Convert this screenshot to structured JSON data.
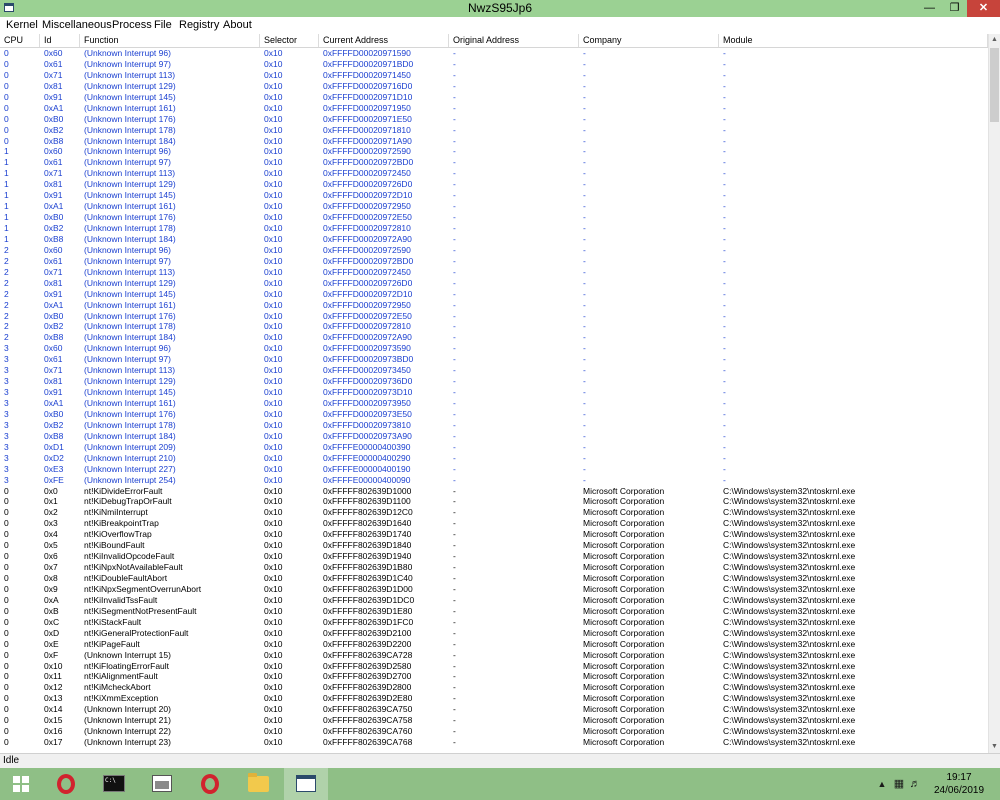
{
  "window": {
    "title": "NwzS95Jp6"
  },
  "menu": [
    "Kernel",
    "Miscellaneous",
    "Process",
    "File",
    "Registry",
    "About"
  ],
  "columns": [
    "CPU",
    "Id",
    "Function",
    "Selector",
    "Current Address",
    "Original Address",
    "Company",
    "Module"
  ],
  "rows": [
    [
      "0",
      "0x60",
      "(Unknown Interrupt 96)",
      "0x10",
      "0xFFFFD00020971590",
      "-",
      "-",
      "-"
    ],
    [
      "0",
      "0x61",
      "(Unknown Interrupt 97)",
      "0x10",
      "0xFFFFD00020971BD0",
      "-",
      "-",
      "-"
    ],
    [
      "0",
      "0x71",
      "(Unknown Interrupt 113)",
      "0x10",
      "0xFFFFD00020971450",
      "-",
      "-",
      "-"
    ],
    [
      "0",
      "0x81",
      "(Unknown Interrupt 129)",
      "0x10",
      "0xFFFFD000209716D0",
      "-",
      "-",
      "-"
    ],
    [
      "0",
      "0x91",
      "(Unknown Interrupt 145)",
      "0x10",
      "0xFFFFD00020971D10",
      "-",
      "-",
      "-"
    ],
    [
      "0",
      "0xA1",
      "(Unknown Interrupt 161)",
      "0x10",
      "0xFFFFD00020971950",
      "-",
      "-",
      "-"
    ],
    [
      "0",
      "0xB0",
      "(Unknown Interrupt 176)",
      "0x10",
      "0xFFFFD00020971E50",
      "-",
      "-",
      "-"
    ],
    [
      "0",
      "0xB2",
      "(Unknown Interrupt 178)",
      "0x10",
      "0xFFFFD00020971810",
      "-",
      "-",
      "-"
    ],
    [
      "0",
      "0xB8",
      "(Unknown Interrupt 184)",
      "0x10",
      "0xFFFFD00020971A90",
      "-",
      "-",
      "-"
    ],
    [
      "1",
      "0x60",
      "(Unknown Interrupt 96)",
      "0x10",
      "0xFFFFD00020972590",
      "-",
      "-",
      "-"
    ],
    [
      "1",
      "0x61",
      "(Unknown Interrupt 97)",
      "0x10",
      "0xFFFFD00020972BD0",
      "-",
      "-",
      "-"
    ],
    [
      "1",
      "0x71",
      "(Unknown Interrupt 113)",
      "0x10",
      "0xFFFFD00020972450",
      "-",
      "-",
      "-"
    ],
    [
      "1",
      "0x81",
      "(Unknown Interrupt 129)",
      "0x10",
      "0xFFFFD000209726D0",
      "-",
      "-",
      "-"
    ],
    [
      "1",
      "0x91",
      "(Unknown Interrupt 145)",
      "0x10",
      "0xFFFFD00020972D10",
      "-",
      "-",
      "-"
    ],
    [
      "1",
      "0xA1",
      "(Unknown Interrupt 161)",
      "0x10",
      "0xFFFFD00020972950",
      "-",
      "-",
      "-"
    ],
    [
      "1",
      "0xB0",
      "(Unknown Interrupt 176)",
      "0x10",
      "0xFFFFD00020972E50",
      "-",
      "-",
      "-"
    ],
    [
      "1",
      "0xB2",
      "(Unknown Interrupt 178)",
      "0x10",
      "0xFFFFD00020972810",
      "-",
      "-",
      "-"
    ],
    [
      "1",
      "0xB8",
      "(Unknown Interrupt 184)",
      "0x10",
      "0xFFFFD00020972A90",
      "-",
      "-",
      "-"
    ],
    [
      "2",
      "0x60",
      "(Unknown Interrupt 96)",
      "0x10",
      "0xFFFFD00020972590",
      "-",
      "-",
      "-"
    ],
    [
      "2",
      "0x61",
      "(Unknown Interrupt 97)",
      "0x10",
      "0xFFFFD00020972BD0",
      "-",
      "-",
      "-"
    ],
    [
      "2",
      "0x71",
      "(Unknown Interrupt 113)",
      "0x10",
      "0xFFFFD00020972450",
      "-",
      "-",
      "-"
    ],
    [
      "2",
      "0x81",
      "(Unknown Interrupt 129)",
      "0x10",
      "0xFFFFD000209726D0",
      "-",
      "-",
      "-"
    ],
    [
      "2",
      "0x91",
      "(Unknown Interrupt 145)",
      "0x10",
      "0xFFFFD00020972D10",
      "-",
      "-",
      "-"
    ],
    [
      "2",
      "0xA1",
      "(Unknown Interrupt 161)",
      "0x10",
      "0xFFFFD00020972950",
      "-",
      "-",
      "-"
    ],
    [
      "2",
      "0xB0",
      "(Unknown Interrupt 176)",
      "0x10",
      "0xFFFFD00020972E50",
      "-",
      "-",
      "-"
    ],
    [
      "2",
      "0xB2",
      "(Unknown Interrupt 178)",
      "0x10",
      "0xFFFFD00020972810",
      "-",
      "-",
      "-"
    ],
    [
      "2",
      "0xB8",
      "(Unknown Interrupt 184)",
      "0x10",
      "0xFFFFD00020972A90",
      "-",
      "-",
      "-"
    ],
    [
      "3",
      "0x60",
      "(Unknown Interrupt 96)",
      "0x10",
      "0xFFFFD00020973590",
      "-",
      "-",
      "-"
    ],
    [
      "3",
      "0x61",
      "(Unknown Interrupt 97)",
      "0x10",
      "0xFFFFD00020973BD0",
      "-",
      "-",
      "-"
    ],
    [
      "3",
      "0x71",
      "(Unknown Interrupt 113)",
      "0x10",
      "0xFFFFD00020973450",
      "-",
      "-",
      "-"
    ],
    [
      "3",
      "0x81",
      "(Unknown Interrupt 129)",
      "0x10",
      "0xFFFFD000209736D0",
      "-",
      "-",
      "-"
    ],
    [
      "3",
      "0x91",
      "(Unknown Interrupt 145)",
      "0x10",
      "0xFFFFD00020973D10",
      "-",
      "-",
      "-"
    ],
    [
      "3",
      "0xA1",
      "(Unknown Interrupt 161)",
      "0x10",
      "0xFFFFD00020973950",
      "-",
      "-",
      "-"
    ],
    [
      "3",
      "0xB0",
      "(Unknown Interrupt 176)",
      "0x10",
      "0xFFFFD00020973E50",
      "-",
      "-",
      "-"
    ],
    [
      "3",
      "0xB2",
      "(Unknown Interrupt 178)",
      "0x10",
      "0xFFFFD00020973810",
      "-",
      "-",
      "-"
    ],
    [
      "3",
      "0xB8",
      "(Unknown Interrupt 184)",
      "0x10",
      "0xFFFFD00020973A90",
      "-",
      "-",
      "-"
    ],
    [
      "3",
      "0xD1",
      "(Unknown Interrupt 209)",
      "0x10",
      "0xFFFFE00000400390",
      "-",
      "-",
      "-"
    ],
    [
      "3",
      "0xD2",
      "(Unknown Interrupt 210)",
      "0x10",
      "0xFFFFE00000400290",
      "-",
      "-",
      "-"
    ],
    [
      "3",
      "0xE3",
      "(Unknown Interrupt 227)",
      "0x10",
      "0xFFFFE00000400190",
      "-",
      "-",
      "-"
    ],
    [
      "3",
      "0xFE",
      "(Unknown Interrupt 254)",
      "0x10",
      "0xFFFFE00000400090",
      "-",
      "-",
      "-"
    ],
    [
      "0",
      "0x0",
      "nt!KiDivideErrorFault",
      "0x10",
      "0xFFFFF802639D1000",
      "-",
      "Microsoft Corporation",
      "C:\\Windows\\system32\\ntoskrnl.exe"
    ],
    [
      "0",
      "0x1",
      "nt!KiDebugTrapOrFault",
      "0x10",
      "0xFFFFF802639D1100",
      "-",
      "Microsoft Corporation",
      "C:\\Windows\\system32\\ntoskrnl.exe"
    ],
    [
      "0",
      "0x2",
      "nt!KiNmiInterrupt",
      "0x10",
      "0xFFFFF802639D12C0",
      "-",
      "Microsoft Corporation",
      "C:\\Windows\\system32\\ntoskrnl.exe"
    ],
    [
      "0",
      "0x3",
      "nt!KiBreakpointTrap",
      "0x10",
      "0xFFFFF802639D1640",
      "-",
      "Microsoft Corporation",
      "C:\\Windows\\system32\\ntoskrnl.exe"
    ],
    [
      "0",
      "0x4",
      "nt!KiOverflowTrap",
      "0x10",
      "0xFFFFF802639D1740",
      "-",
      "Microsoft Corporation",
      "C:\\Windows\\system32\\ntoskrnl.exe"
    ],
    [
      "0",
      "0x5",
      "nt!KiBoundFault",
      "0x10",
      "0xFFFFF802639D1840",
      "-",
      "Microsoft Corporation",
      "C:\\Windows\\system32\\ntoskrnl.exe"
    ],
    [
      "0",
      "0x6",
      "nt!KiInvalidOpcodeFault",
      "0x10",
      "0xFFFFF802639D1940",
      "-",
      "Microsoft Corporation",
      "C:\\Windows\\system32\\ntoskrnl.exe"
    ],
    [
      "0",
      "0x7",
      "nt!KiNpxNotAvailableFault",
      "0x10",
      "0xFFFFF802639D1B80",
      "-",
      "Microsoft Corporation",
      "C:\\Windows\\system32\\ntoskrnl.exe"
    ],
    [
      "0",
      "0x8",
      "nt!KiDoubleFaultAbort",
      "0x10",
      "0xFFFFF802639D1C40",
      "-",
      "Microsoft Corporation",
      "C:\\Windows\\system32\\ntoskrnl.exe"
    ],
    [
      "0",
      "0x9",
      "nt!KiNpxSegmentOverrunAbort",
      "0x10",
      "0xFFFFF802639D1D00",
      "-",
      "Microsoft Corporation",
      "C:\\Windows\\system32\\ntoskrnl.exe"
    ],
    [
      "0",
      "0xA",
      "nt!KiInvalidTssFault",
      "0x10",
      "0xFFFFF802639D1DC0",
      "-",
      "Microsoft Corporation",
      "C:\\Windows\\system32\\ntoskrnl.exe"
    ],
    [
      "0",
      "0xB",
      "nt!KiSegmentNotPresentFault",
      "0x10",
      "0xFFFFF802639D1E80",
      "-",
      "Microsoft Corporation",
      "C:\\Windows\\system32\\ntoskrnl.exe"
    ],
    [
      "0",
      "0xC",
      "nt!KiStackFault",
      "0x10",
      "0xFFFFF802639D1FC0",
      "-",
      "Microsoft Corporation",
      "C:\\Windows\\system32\\ntoskrnl.exe"
    ],
    [
      "0",
      "0xD",
      "nt!KiGeneralProtectionFault",
      "0x10",
      "0xFFFFF802639D2100",
      "-",
      "Microsoft Corporation",
      "C:\\Windows\\system32\\ntoskrnl.exe"
    ],
    [
      "0",
      "0xE",
      "nt!KiPageFault",
      "0x10",
      "0xFFFFF802639D2200",
      "-",
      "Microsoft Corporation",
      "C:\\Windows\\system32\\ntoskrnl.exe"
    ],
    [
      "0",
      "0xF",
      "(Unknown Interrupt 15)",
      "0x10",
      "0xFFFFF802639CA728",
      "-",
      "Microsoft Corporation",
      "C:\\Windows\\system32\\ntoskrnl.exe"
    ],
    [
      "0",
      "0x10",
      "nt!KiFloatingErrorFault",
      "0x10",
      "0xFFFFF802639D2580",
      "-",
      "Microsoft Corporation",
      "C:\\Windows\\system32\\ntoskrnl.exe"
    ],
    [
      "0",
      "0x11",
      "nt!KiAlignmentFault",
      "0x10",
      "0xFFFFF802639D2700",
      "-",
      "Microsoft Corporation",
      "C:\\Windows\\system32\\ntoskrnl.exe"
    ],
    [
      "0",
      "0x12",
      "nt!KiMcheckAbort",
      "0x10",
      "0xFFFFF802639D2800",
      "-",
      "Microsoft Corporation",
      "C:\\Windows\\system32\\ntoskrnl.exe"
    ],
    [
      "0",
      "0x13",
      "nt!KiXmmException",
      "0x10",
      "0xFFFFF802639D2E80",
      "-",
      "Microsoft Corporation",
      "C:\\Windows\\system32\\ntoskrnl.exe"
    ],
    [
      "0",
      "0x14",
      "(Unknown Interrupt 20)",
      "0x10",
      "0xFFFFF802639CA750",
      "-",
      "Microsoft Corporation",
      "C:\\Windows\\system32\\ntoskrnl.exe"
    ],
    [
      "0",
      "0x15",
      "(Unknown Interrupt 21)",
      "0x10",
      "0xFFFFF802639CA758",
      "-",
      "Microsoft Corporation",
      "C:\\Windows\\system32\\ntoskrnl.exe"
    ],
    [
      "0",
      "0x16",
      "(Unknown Interrupt 22)",
      "0x10",
      "0xFFFFF802639CA760",
      "-",
      "Microsoft Corporation",
      "C:\\Windows\\system32\\ntoskrnl.exe"
    ],
    [
      "0",
      "0x17",
      "(Unknown Interrupt 23)",
      "0x10",
      "0xFFFFF802639CA768",
      "-",
      "Microsoft Corporation",
      "C:\\Windows\\system32\\ntoskrnl.exe"
    ]
  ],
  "row_colors": {
    "blue": "#1a3fd0",
    "black": "#000000"
  },
  "status": {
    "text": "Idle"
  },
  "taskbar": {
    "color": "#8fbf86",
    "apps": [
      "windows-logo-icon",
      "opera-icon",
      "cmd-icon",
      "resource-monitor-icon",
      "opera-icon",
      "file-explorer-icon",
      "app-window-icon"
    ]
  },
  "clock": {
    "time": "19:17",
    "date": "24/06/2019"
  }
}
